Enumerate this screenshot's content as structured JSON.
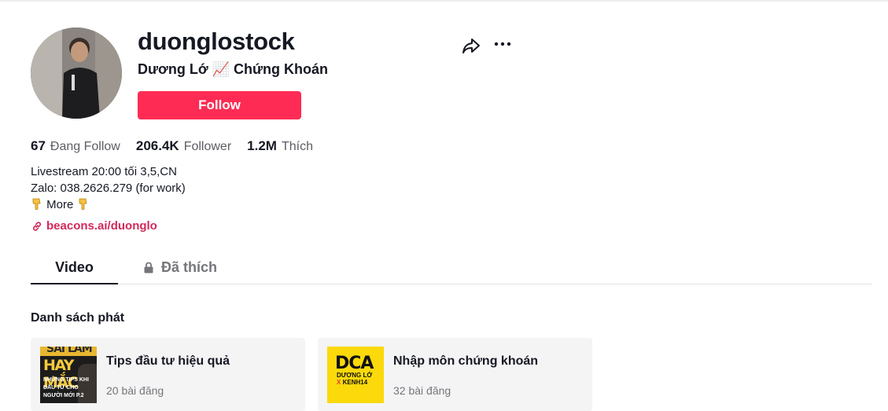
{
  "profile": {
    "username": "duonglostock",
    "nickname": "Dương Lớ 📈 Chứng Khoán",
    "follow_label": "Follow"
  },
  "stats": {
    "following_count": "67",
    "following_label": "Đang Follow",
    "followers_count": "206.4K",
    "followers_label": "Follower",
    "likes_count": "1.2M",
    "likes_label": "Thích"
  },
  "bio": {
    "line1": "Livestream 20:00 tối 3,5,CN",
    "line2": "Zalo: 038.2626.279 (for work)",
    "line3_text": "More"
  },
  "link": {
    "text": "beacons.ai/duonglo",
    "icon": "link-icon"
  },
  "tabs": {
    "video": "Video",
    "liked": "Đã thích"
  },
  "playlists": {
    "section_title": "Danh sách phát",
    "items": [
      {
        "title": "Tips đầu tư hiệu quả",
        "count": "20 bài đăng",
        "thumb_top": "SAI LẦM",
        "thumb_big": "HAY MẮC",
        "thumb_line1": "NHỮNG TIPS KHI",
        "thumb_line2": "ĐẦU TƯ CHO",
        "thumb_line3": "NGƯỜI MỚI P.2"
      },
      {
        "title": "Nhập môn chứng khoán",
        "count": "32 bài đăng",
        "thumb_big": "DCA",
        "thumb_line1": "DƯƠNG LỚ",
        "thumb_line2_x": "X",
        "thumb_line2": "KENH14"
      }
    ]
  },
  "colors": {
    "accent": "#fe2c55",
    "link": "#d2285a",
    "muted": "#75767b"
  }
}
